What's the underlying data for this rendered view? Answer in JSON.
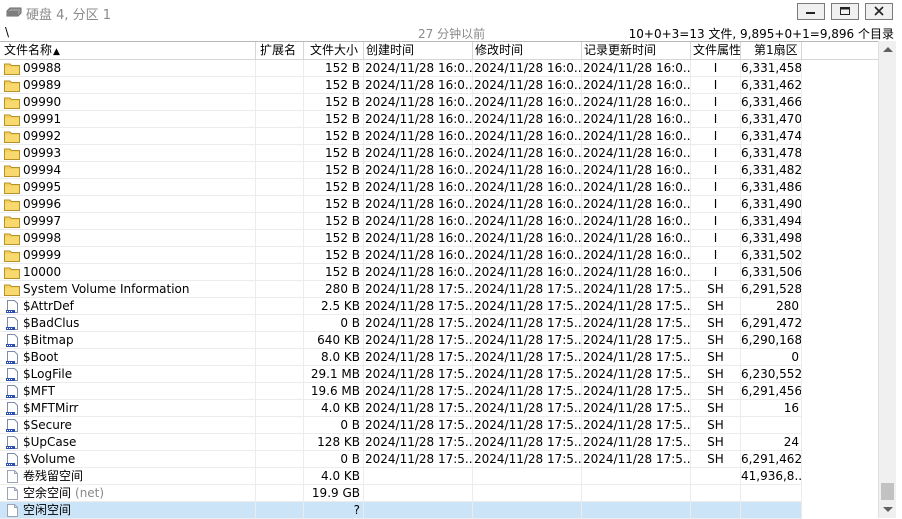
{
  "window": {
    "title": "硬盘 4, 分区 1",
    "buttons": [
      "minimize",
      "maximize",
      "close"
    ]
  },
  "infobar": {
    "path": "\\",
    "snapshot_age": "27 分钟以前",
    "summary": "10+0+3=13 文件, 9,895+0+1=9,896 个目录"
  },
  "columns": {
    "name": "文件名称",
    "ext": "扩展名",
    "size": "文件大小",
    "created": "创建时间",
    "modified": "修改时间",
    "record_updated": "记录更新时间",
    "attr": "文件属性",
    "first_sector": "第1扇区"
  },
  "sort_indicator": "▲",
  "rows": [
    {
      "icon": "folder-icon",
      "name": "09988",
      "ext": "",
      "size": "152 B",
      "created": "2024/11/28  16:0...",
      "modified": "2024/11/28  16:0...",
      "record_updated": "2024/11/28  16:0...",
      "attr": "I",
      "first_sector": "6,331,458"
    },
    {
      "icon": "folder-icon",
      "name": "09989",
      "ext": "",
      "size": "152 B",
      "created": "2024/11/28  16:0...",
      "modified": "2024/11/28  16:0...",
      "record_updated": "2024/11/28  16:0...",
      "attr": "I",
      "first_sector": "6,331,462"
    },
    {
      "icon": "folder-icon",
      "name": "09990",
      "ext": "",
      "size": "152 B",
      "created": "2024/11/28  16:0...",
      "modified": "2024/11/28  16:0...",
      "record_updated": "2024/11/28  16:0...",
      "attr": "I",
      "first_sector": "6,331,466"
    },
    {
      "icon": "folder-icon",
      "name": "09991",
      "ext": "",
      "size": "152 B",
      "created": "2024/11/28  16:0...",
      "modified": "2024/11/28  16:0...",
      "record_updated": "2024/11/28  16:0...",
      "attr": "I",
      "first_sector": "6,331,470"
    },
    {
      "icon": "folder-icon",
      "name": "09992",
      "ext": "",
      "size": "152 B",
      "created": "2024/11/28  16:0...",
      "modified": "2024/11/28  16:0...",
      "record_updated": "2024/11/28  16:0...",
      "attr": "I",
      "first_sector": "6,331,474"
    },
    {
      "icon": "folder-icon",
      "name": "09993",
      "ext": "",
      "size": "152 B",
      "created": "2024/11/28  16:0...",
      "modified": "2024/11/28  16:0...",
      "record_updated": "2024/11/28  16:0...",
      "attr": "I",
      "first_sector": "6,331,478"
    },
    {
      "icon": "folder-icon",
      "name": "09994",
      "ext": "",
      "size": "152 B",
      "created": "2024/11/28  16:0...",
      "modified": "2024/11/28  16:0...",
      "record_updated": "2024/11/28  16:0...",
      "attr": "I",
      "first_sector": "6,331,482"
    },
    {
      "icon": "folder-icon",
      "name": "09995",
      "ext": "",
      "size": "152 B",
      "created": "2024/11/28  16:0...",
      "modified": "2024/11/28  16:0...",
      "record_updated": "2024/11/28  16:0...",
      "attr": "I",
      "first_sector": "6,331,486"
    },
    {
      "icon": "folder-icon",
      "name": "09996",
      "ext": "",
      "size": "152 B",
      "created": "2024/11/28  16:0...",
      "modified": "2024/11/28  16:0...",
      "record_updated": "2024/11/28  16:0...",
      "attr": "I",
      "first_sector": "6,331,490"
    },
    {
      "icon": "folder-icon",
      "name": "09997",
      "ext": "",
      "size": "152 B",
      "created": "2024/11/28  16:0...",
      "modified": "2024/11/28  16:0...",
      "record_updated": "2024/11/28  16:0...",
      "attr": "I",
      "first_sector": "6,331,494"
    },
    {
      "icon": "folder-icon",
      "name": "09998",
      "ext": "",
      "size": "152 B",
      "created": "2024/11/28  16:0...",
      "modified": "2024/11/28  16:0...",
      "record_updated": "2024/11/28  16:0...",
      "attr": "I",
      "first_sector": "6,331,498"
    },
    {
      "icon": "folder-icon",
      "name": "09999",
      "ext": "",
      "size": "152 B",
      "created": "2024/11/28  16:0...",
      "modified": "2024/11/28  16:0...",
      "record_updated": "2024/11/28  16:0...",
      "attr": "I",
      "first_sector": "6,331,502"
    },
    {
      "icon": "folder-icon",
      "name": "10000",
      "ext": "",
      "size": "152 B",
      "created": "2024/11/28  16:0...",
      "modified": "2024/11/28  16:0...",
      "record_updated": "2024/11/28  16:0...",
      "attr": "I",
      "first_sector": "6,331,506"
    },
    {
      "icon": "folder-icon",
      "name": "System Volume Information",
      "ext": "",
      "size": "280 B",
      "created": "2024/11/28  17:5...",
      "modified": "2024/11/28  17:5...",
      "record_updated": "2024/11/28  17:5...",
      "attr": "SH",
      "first_sector": "6,291,528"
    },
    {
      "icon": "system-file-icon",
      "name": "$AttrDef",
      "ext": "",
      "size": "2.5 KB",
      "created": "2024/11/28  17:5...",
      "modified": "2024/11/28  17:5...",
      "record_updated": "2024/11/28  17:5...",
      "attr": "SH",
      "first_sector": "280"
    },
    {
      "icon": "system-file-icon",
      "name": "$BadClus",
      "ext": "",
      "size": "0 B",
      "created": "2024/11/28  17:5...",
      "modified": "2024/11/28  17:5...",
      "record_updated": "2024/11/28  17:5...",
      "attr": "SH",
      "first_sector": "6,291,472"
    },
    {
      "icon": "system-file-icon",
      "name": "$Bitmap",
      "ext": "",
      "size": "640 KB",
      "created": "2024/11/28  17:5...",
      "modified": "2024/11/28  17:5...",
      "record_updated": "2024/11/28  17:5...",
      "attr": "SH",
      "first_sector": "6,290,168"
    },
    {
      "icon": "system-file-icon",
      "name": "$Boot",
      "ext": "",
      "size": "8.0 KB",
      "created": "2024/11/28  17:5...",
      "modified": "2024/11/28  17:5...",
      "record_updated": "2024/11/28  17:5...",
      "attr": "SH",
      "first_sector": "0"
    },
    {
      "icon": "system-file-icon",
      "name": "$LogFile",
      "ext": "",
      "size": "29.1 MB",
      "created": "2024/11/28  17:5...",
      "modified": "2024/11/28  17:5...",
      "record_updated": "2024/11/28  17:5...",
      "attr": "SH",
      "first_sector": "6,230,552"
    },
    {
      "icon": "system-file-icon",
      "name": "$MFT",
      "ext": "",
      "size": "19.6 MB",
      "created": "2024/11/28  17:5...",
      "modified": "2024/11/28  17:5...",
      "record_updated": "2024/11/28  17:5...",
      "attr": "SH",
      "first_sector": "6,291,456"
    },
    {
      "icon": "system-file-icon",
      "name": "$MFTMirr",
      "ext": "",
      "size": "4.0 KB",
      "created": "2024/11/28  17:5...",
      "modified": "2024/11/28  17:5...",
      "record_updated": "2024/11/28  17:5...",
      "attr": "SH",
      "first_sector": "16"
    },
    {
      "icon": "system-file-icon",
      "name": "$Secure",
      "ext": "",
      "size": "0 B",
      "created": "2024/11/28  17:5...",
      "modified": "2024/11/28  17:5...",
      "record_updated": "2024/11/28  17:5...",
      "attr": "SH",
      "first_sector": ""
    },
    {
      "icon": "system-file-icon",
      "name": "$UpCase",
      "ext": "",
      "size": "128 KB",
      "created": "2024/11/28  17:5...",
      "modified": "2024/11/28  17:5...",
      "record_updated": "2024/11/28  17:5...",
      "attr": "SH",
      "first_sector": "24"
    },
    {
      "icon": "system-file-icon",
      "name": "$Volume",
      "ext": "",
      "size": "0 B",
      "created": "2024/11/28  17:5...",
      "modified": "2024/11/28  17:5...",
      "record_updated": "2024/11/28  17:5...",
      "attr": "SH",
      "first_sector": "6,291,462"
    },
    {
      "icon": "virtual-file-icon",
      "name": "卷残留空间",
      "ext": "",
      "size": "4.0 KB",
      "created": "",
      "modified": "",
      "record_updated": "",
      "attr": "",
      "first_sector": "41,936,8..."
    },
    {
      "icon": "virtual-file-icon",
      "name": "空余空间",
      "name_suffix": "(net)",
      "ext": "",
      "size": "19.9 GB",
      "created": "",
      "modified": "",
      "record_updated": "",
      "attr": "",
      "first_sector": ""
    },
    {
      "icon": "virtual-file-icon",
      "name": "空闲空间",
      "ext": "",
      "size": "?",
      "created": "",
      "modified": "",
      "record_updated": "",
      "attr": "",
      "first_sector": "",
      "selected": true
    }
  ],
  "colors": {
    "selection": "#cce4f7",
    "folder": "#e8c24a",
    "system_file_mark": "#2b4fb0",
    "grey_text": "#8a8a8a"
  }
}
